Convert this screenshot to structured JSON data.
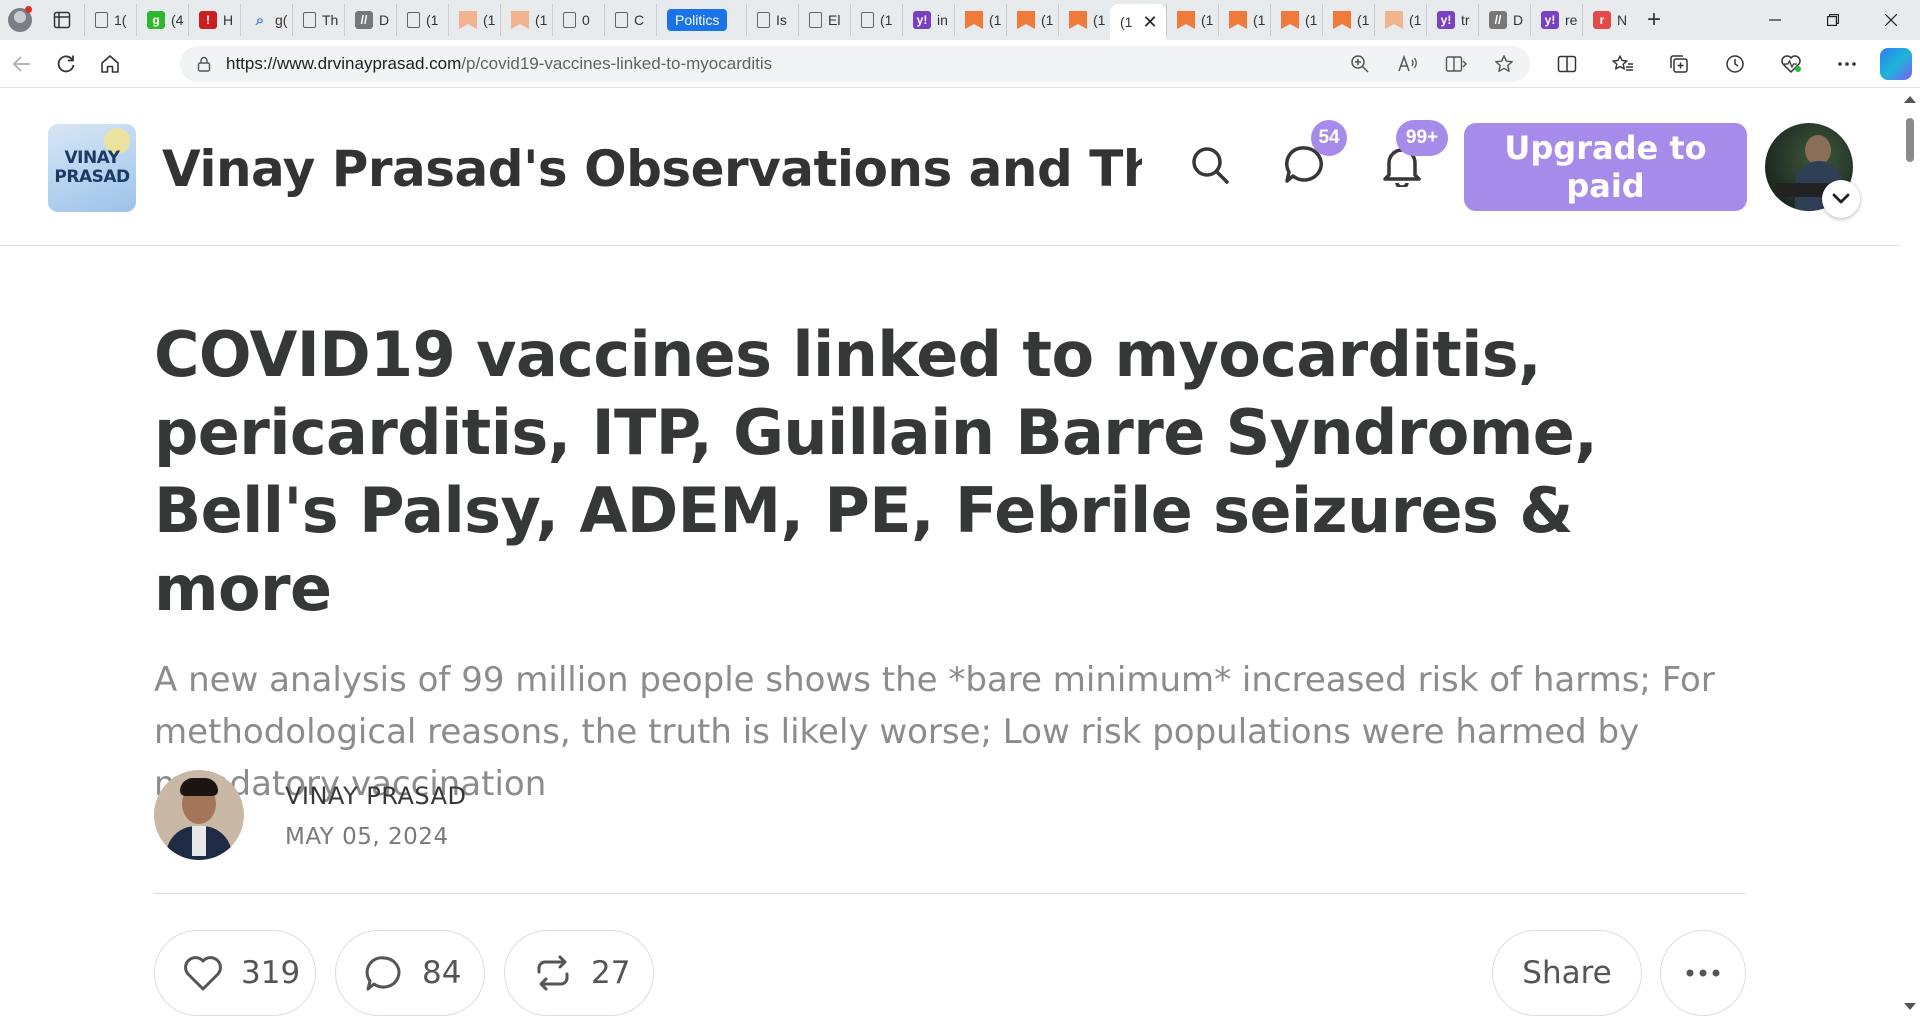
{
  "browser": {
    "tabs": [
      {
        "favicon": "doc",
        "label": "1("
      },
      {
        "favicon": "green-g",
        "label": "(4"
      },
      {
        "favicon": "red-h",
        "label": "H"
      },
      {
        "favicon": "search",
        "label": "g("
      },
      {
        "favicon": "doc",
        "label": "Th"
      },
      {
        "favicon": "gray",
        "label": "D"
      },
      {
        "favicon": "doc",
        "label": "(1"
      },
      {
        "favicon": "bookmark-light",
        "label": "(1"
      },
      {
        "favicon": "bookmark-light",
        "label": "(1"
      },
      {
        "favicon": "doc",
        "label": "0"
      },
      {
        "favicon": "doc",
        "label": "C"
      },
      {
        "favicon": "pill",
        "label": "Politics"
      },
      {
        "favicon": "doc",
        "label": "Is"
      },
      {
        "favicon": "doc",
        "label": "El"
      },
      {
        "favicon": "doc",
        "label": "(1"
      },
      {
        "favicon": "yahoo",
        "label": "in"
      },
      {
        "favicon": "bookmark",
        "label": "(1"
      },
      {
        "favicon": "bookmark",
        "label": "(1"
      },
      {
        "favicon": "bookmark",
        "label": "(1"
      },
      {
        "favicon": "active",
        "label": "(1"
      },
      {
        "favicon": "bookmark",
        "label": "(1"
      },
      {
        "favicon": "bookmark",
        "label": "(1"
      },
      {
        "favicon": "bookmark",
        "label": "(1"
      },
      {
        "favicon": "bookmark",
        "label": "(1"
      },
      {
        "favicon": "bookmark-light",
        "label": "(1"
      },
      {
        "favicon": "yahoo",
        "label": "tr"
      },
      {
        "favicon": "gray",
        "label": "D"
      },
      {
        "favicon": "yahoo",
        "label": "re"
      },
      {
        "favicon": "rr",
        "label": "N"
      }
    ],
    "new_tab_label": "+",
    "url_host": "https://www.drvinayprasad.com",
    "url_path": "/p/covid19-vaccines-linked-to-myocarditis",
    "accent": "#1a73e8"
  },
  "site": {
    "logo_line1": "VINAY",
    "logo_line2": "PRASAD",
    "title": "Vinay Prasad's Observations and Thou...",
    "chat_badge": "54",
    "notif_badge": "99+",
    "upgrade_label": "Upgrade to paid",
    "accent": "#a78bea"
  },
  "article": {
    "title": "COVID19 vaccines linked to myocarditis, pericarditis, ITP, Guillain Barre Syndrome, Bell's Palsy, ADEM, PE, Febrile seizures & more",
    "subtitle": "A new analysis of 99 million people shows the *bare minimum* increased risk of harms; For methodological reasons, the truth is likely worse; Low risk populations were harmed by mandatory vaccination",
    "author": "VINAY PRASAD",
    "date": "MAY 05, 2024"
  },
  "actions": {
    "likes": "319",
    "comments": "84",
    "restacks": "27",
    "share_label": "Share"
  }
}
